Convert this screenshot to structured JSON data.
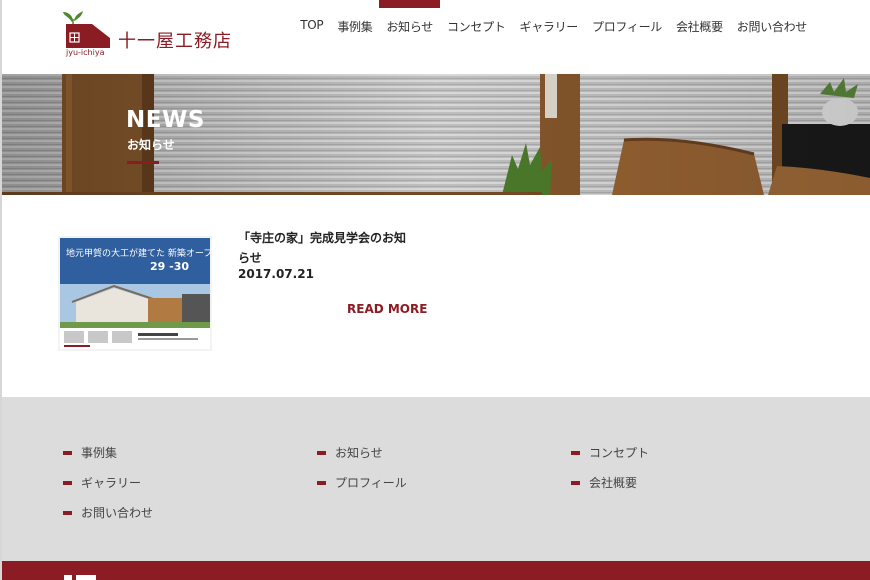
{
  "header": {
    "logo_text": "十一屋工務店",
    "logo_sub": "jyu-ichiya",
    "logo_mark": "田",
    "brand_color": "#8b1c24"
  },
  "nav": {
    "items": [
      {
        "label": "TOP",
        "active": false
      },
      {
        "label": "事例集",
        "active": false
      },
      {
        "label": "お知らせ",
        "active": true
      },
      {
        "label": "コンセプト",
        "active": false
      },
      {
        "label": "ギャラリー",
        "active": false
      },
      {
        "label": "プロフィール",
        "active": false
      },
      {
        "label": "会社概要",
        "active": false
      },
      {
        "label": "お問い合わせ",
        "active": false
      }
    ]
  },
  "hero": {
    "title": "NEWS",
    "subtitle": "お知らせ"
  },
  "news": {
    "items": [
      {
        "title": "「寺庄の家」完成見学会のお知らせ",
        "date": "2017.07.21",
        "read_more": "READ MORE",
        "thumb_headline": "地元甲賀の大工が建てた 新築オープンハウス",
        "thumb_date": "29 -30"
      }
    ]
  },
  "footer": {
    "links": [
      "事例集",
      "お知らせ",
      "コンセプト",
      "ギャラリー",
      "プロフィール",
      "会社概要",
      "お問い合わせ"
    ]
  }
}
